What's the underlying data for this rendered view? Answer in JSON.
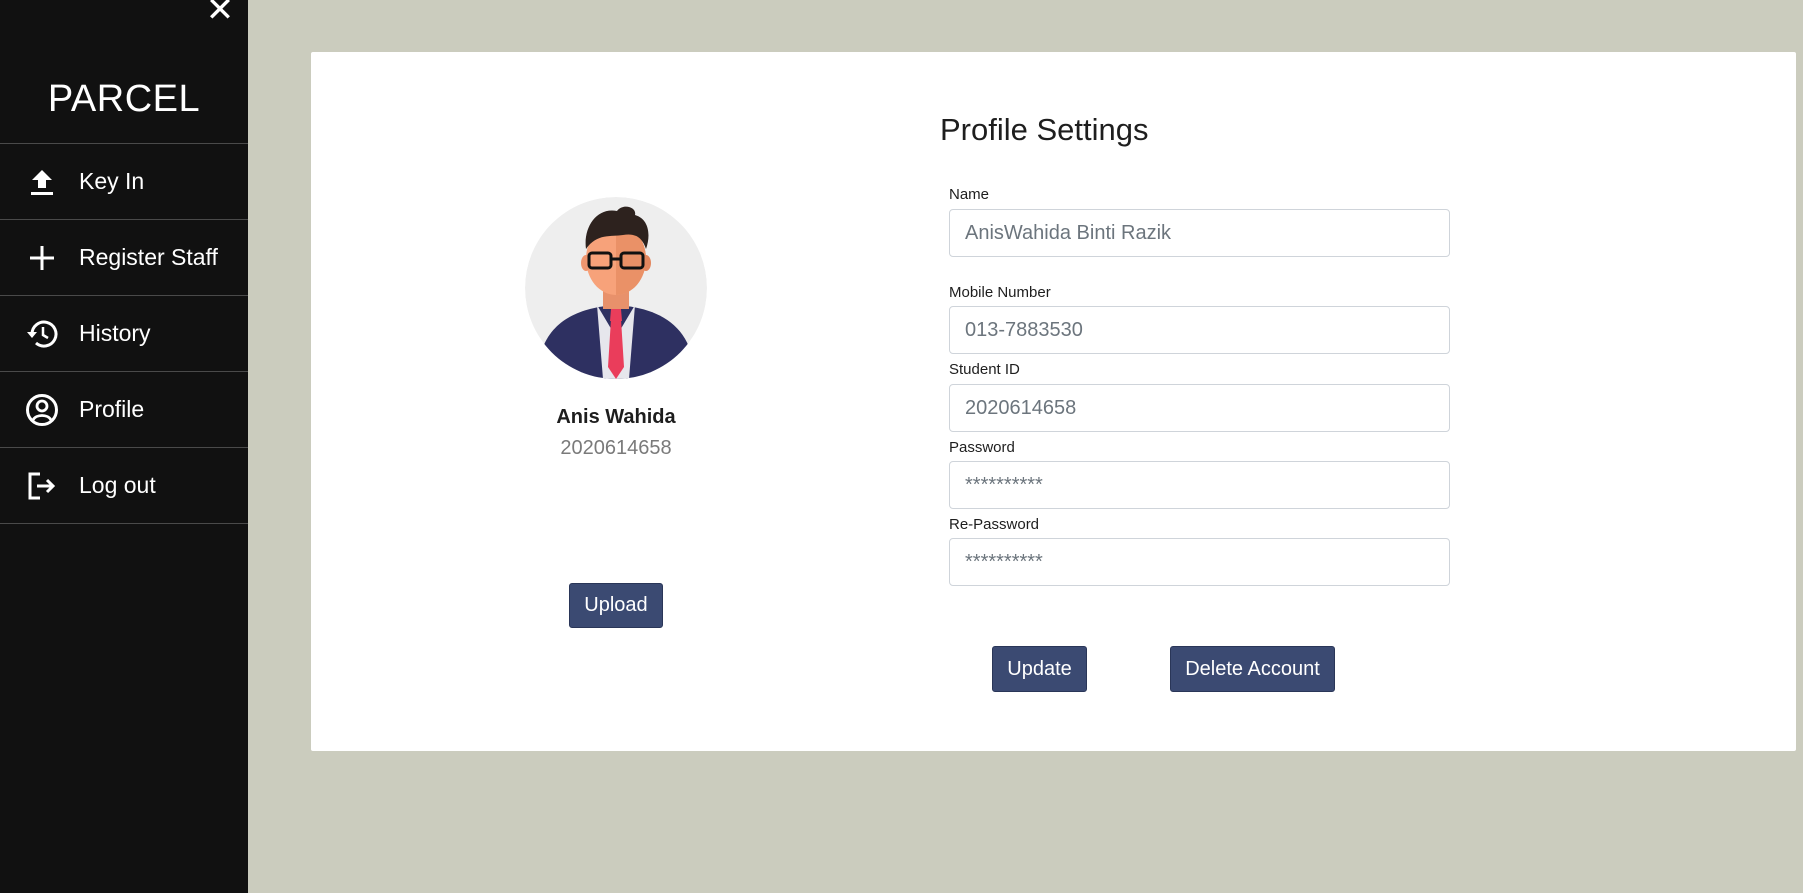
{
  "sidebar": {
    "close_label": "✕",
    "brand": "PARCEL",
    "items": [
      {
        "label": "Key In",
        "icon": "upload-icon"
      },
      {
        "label": "Register Staff",
        "icon": "plus-icon"
      },
      {
        "label": "History",
        "icon": "history-icon"
      },
      {
        "label": "Profile",
        "icon": "account-circle-icon"
      },
      {
        "label": "Log out",
        "icon": "logout-icon"
      }
    ]
  },
  "profile": {
    "name": "Anis Wahida",
    "id": "2020614658",
    "upload_label": "Upload"
  },
  "settings": {
    "title": "Profile Settings",
    "fields": {
      "name": {
        "label": "Name",
        "value": "AnisWahida Binti Razik"
      },
      "mobile": {
        "label": "Mobile Number",
        "value": "013-7883530"
      },
      "student_id": {
        "label": "Student ID",
        "value": "2020614658"
      },
      "password": {
        "label": "Password",
        "value": "**********"
      },
      "repassword": {
        "label": "Re-Password",
        "value": "**********"
      }
    },
    "update_label": "Update",
    "delete_label": "Delete Account"
  },
  "colors": {
    "background": "#cbccbe",
    "sidebar": "#111111",
    "button": "#3b4a72"
  }
}
